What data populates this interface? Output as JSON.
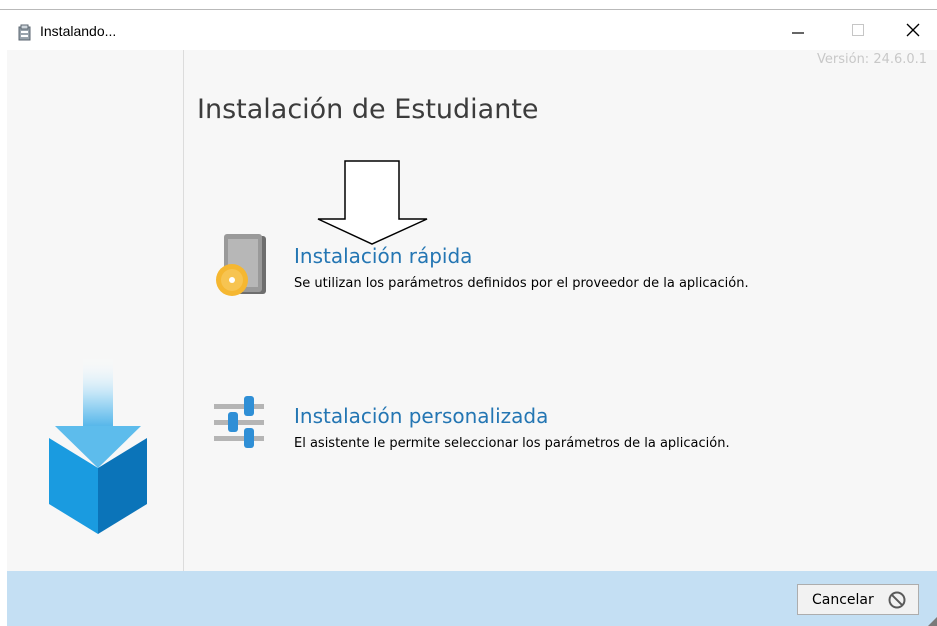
{
  "window": {
    "title": "Instalando...",
    "title_icon": "installer-box-icon",
    "controls": [
      "minimize-icon",
      "maximize-icon",
      "close-icon"
    ]
  },
  "header": {
    "version": "Versión: 24.6.0.1"
  },
  "main": {
    "title": "Instalación de Estudiante",
    "options": [
      {
        "title": "Instalación rápida",
        "description": "Se utilizan los parámetros definidos por el proveedor de la aplicación.",
        "icon": "package-disc-icon"
      },
      {
        "title": "Instalación personalizada",
        "description": "El asistente le permite seleccionar los parámetros de la aplicación.",
        "icon": "settings-sliders-icon"
      }
    ]
  },
  "sidebar": {
    "logo_icon": "download-box-logo-icon"
  },
  "footer": {
    "cancel_label": "Cancelar",
    "cancel_icon": "prohibited-icon"
  },
  "colors": {
    "link_blue": "#2476b3",
    "footer_bg": "#c4dff3",
    "content_bg": "#f7f7f7"
  }
}
